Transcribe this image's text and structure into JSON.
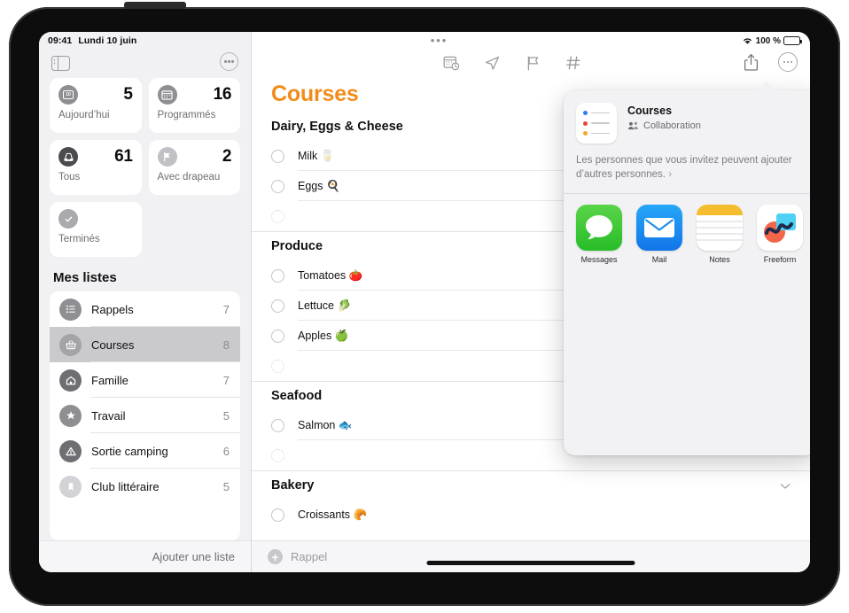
{
  "status_bar": {
    "time": "09:41",
    "date": "Lundi 10 juin",
    "multitask_dots": "•••",
    "wifi_icon": "wifi-icon",
    "battery_percent": "100 %"
  },
  "sidebar": {
    "toggle_icon": "sidebar-toggle-icon",
    "more_icon": "more-ellipsis-icon",
    "smart_lists": [
      {
        "label": "Aujourd’hui",
        "count": "5",
        "icon": "calendar-day-icon"
      },
      {
        "label": "Programmés",
        "count": "16",
        "icon": "calendar-icon"
      },
      {
        "label": "Tous",
        "count": "61",
        "icon": "inbox-tray-icon"
      },
      {
        "label": "Avec drapeau",
        "count": "2",
        "icon": "flag-icon"
      },
      {
        "label": "Terminés",
        "count": "",
        "icon": "checkmark-circle-icon"
      }
    ],
    "my_lists_title": "Mes listes",
    "lists": [
      {
        "name": "Rappels",
        "count": "7",
        "icon": "bullet-list-icon",
        "selected": false
      },
      {
        "name": "Courses",
        "count": "8",
        "icon": "basket-icon",
        "selected": true
      },
      {
        "name": "Famille",
        "count": "7",
        "icon": "house-icon",
        "selected": false
      },
      {
        "name": "Travail",
        "count": "5",
        "icon": "star-icon",
        "selected": false
      },
      {
        "name": "Sortie camping",
        "count": "6",
        "icon": "tent-icon",
        "selected": false
      },
      {
        "name": "Club littéraire",
        "count": "5",
        "icon": "bookmark-icon",
        "selected": false
      }
    ],
    "add_list_label": "Ajouter une liste"
  },
  "main": {
    "toolbar_icons": [
      "calendar-clock-icon",
      "location-arrow-icon",
      "flag-icon",
      "hashtag-icon"
    ],
    "share_icon": "share-icon",
    "more_icon": "more-ellipsis-icon",
    "title": "Courses",
    "title_color": "#f18c1c",
    "sections": [
      {
        "name": "Dairy, Eggs & Cheese",
        "collapsible": false,
        "items": [
          {
            "text": "Milk 🥛",
            "placeholder": false
          },
          {
            "text": "Eggs 🍳",
            "placeholder": false
          },
          {
            "text": "",
            "placeholder": true
          }
        ]
      },
      {
        "name": "Produce",
        "collapsible": false,
        "items": [
          {
            "text": "Tomatoes 🍅",
            "placeholder": false
          },
          {
            "text": "Lettuce 🥬",
            "placeholder": false
          },
          {
            "text": "Apples 🍏",
            "placeholder": false
          },
          {
            "text": "",
            "placeholder": true
          }
        ]
      },
      {
        "name": "Seafood",
        "collapsible": false,
        "items": [
          {
            "text": "Salmon 🐟",
            "placeholder": false
          },
          {
            "text": "",
            "placeholder": true
          }
        ]
      },
      {
        "name": "Bakery",
        "collapsible": true,
        "chevron": "chevron-down-icon",
        "items": [
          {
            "text": "Croissants 🥐",
            "placeholder": false
          }
        ]
      }
    ],
    "add_reminder_label": "Rappel",
    "add_icon": "plus-circle-icon"
  },
  "share_popover": {
    "doc_icon": "reminders-list-icon",
    "title": "Courses",
    "subtitle": "Collaboration",
    "subtitle_icon": "people-icon",
    "note": "Les personnes que vous invitez peuvent ajouter d’autres personnes.",
    "note_chevron": "chevron-right-icon",
    "apps": [
      {
        "label": "Messages",
        "icon": "messages-app-icon"
      },
      {
        "label": "Mail",
        "icon": "mail-app-icon"
      },
      {
        "label": "Notes",
        "icon": "notes-app-icon"
      },
      {
        "label": "Freeform",
        "icon": "freeform-app-icon"
      }
    ]
  }
}
